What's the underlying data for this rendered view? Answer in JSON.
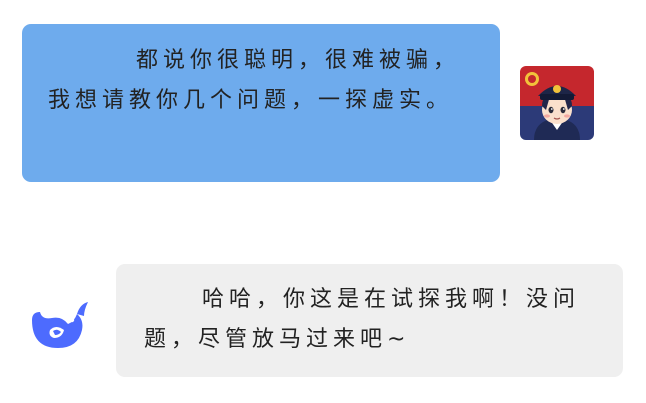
{
  "conversation": {
    "messages": [
      {
        "role": "user",
        "avatar_icon": "police-avatar-icon",
        "text": "都说你很聪明，很难被骗，我想请教你几个问题，一探虚实。"
      },
      {
        "role": "assistant",
        "avatar_icon": "deepseek-whale-icon",
        "text": "哈哈，你这是在试探我啊！没问题，尽管放马过来吧~"
      }
    ]
  },
  "colors": {
    "user_bubble": "#6eabed",
    "assistant_bubble": "#efefef",
    "whale_logo": "#4d6bfe",
    "police_bg_top": "#c5272d",
    "police_bg_bottom": "#2c3a78"
  }
}
